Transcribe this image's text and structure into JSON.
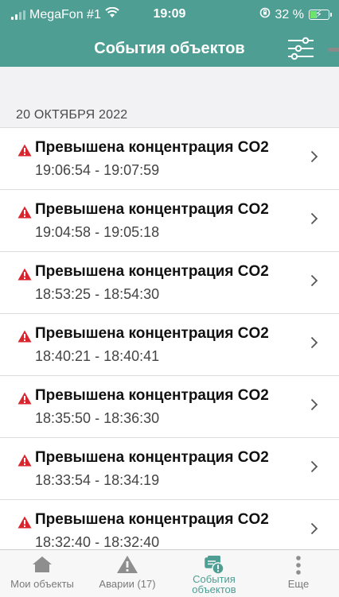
{
  "status_bar": {
    "carrier": "MegaFon #1",
    "time": "19:09",
    "battery_text": "32 %"
  },
  "header": {
    "title": "События объектов",
    "filter_icon": "filter-sliders-icon"
  },
  "section": {
    "date": "20 ОКТЯБРЯ 2022"
  },
  "events": [
    {
      "title": "Превышена концентрация CO2",
      "time": "19:06:54 - 19:07:59"
    },
    {
      "title": "Превышена концентрация CO2",
      "time": "19:04:58 - 19:05:18"
    },
    {
      "title": "Превышена концентрация CO2",
      "time": "18:53:25 - 18:54:30"
    },
    {
      "title": "Превышена концентрация CO2",
      "time": "18:40:21 - 18:40:41"
    },
    {
      "title": "Превышена концентрация CO2",
      "time": "18:35:50 - 18:36:30"
    },
    {
      "title": "Превышена концентрация CO2",
      "time": "18:33:54 - 18:34:19"
    },
    {
      "title": "Превышена концентрация CO2",
      "time": "18:32:40 - 18:32:40"
    }
  ],
  "tabbar": {
    "tabs": [
      {
        "label": "Мои объекты",
        "icon": "house-icon"
      },
      {
        "label": "Аварии (17)",
        "icon": "warning-triangle-icon"
      },
      {
        "label": "События объектов",
        "icon": "events-stack-icon",
        "active": true
      },
      {
        "label": "Еще",
        "icon": "more-dots-icon"
      }
    ]
  },
  "colors": {
    "header": "#4e9e93",
    "warning": "#d9262e",
    "active_tab": "#4e9e93",
    "inactive_tab": "#8e8e8e",
    "battery_fill": "#6ee36e"
  }
}
